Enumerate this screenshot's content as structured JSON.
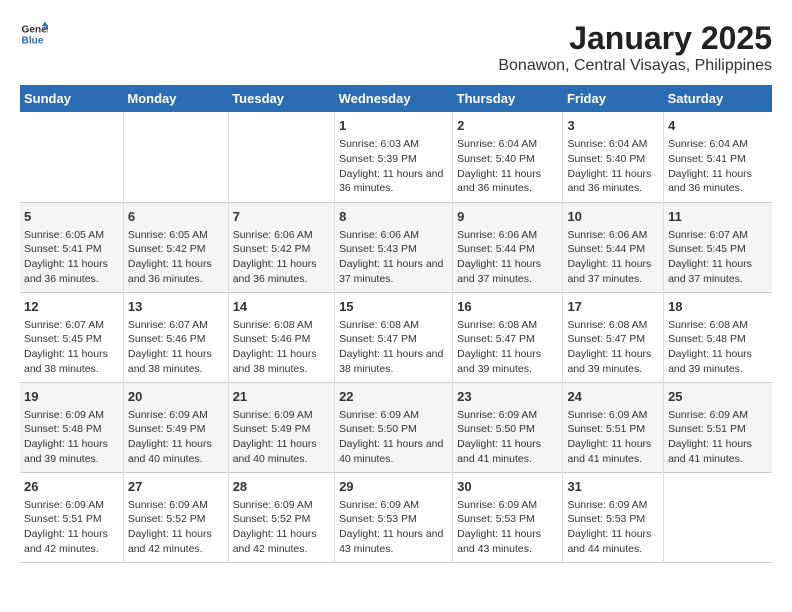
{
  "header": {
    "logo_general": "General",
    "logo_blue": "Blue",
    "title": "January 2025",
    "subtitle": "Bonawon, Central Visayas, Philippines"
  },
  "days_of_week": [
    "Sunday",
    "Monday",
    "Tuesday",
    "Wednesday",
    "Thursday",
    "Friday",
    "Saturday"
  ],
  "weeks": [
    [
      {
        "day": "",
        "info": ""
      },
      {
        "day": "",
        "info": ""
      },
      {
        "day": "",
        "info": ""
      },
      {
        "day": "1",
        "sunrise": "Sunrise: 6:03 AM",
        "sunset": "Sunset: 5:39 PM",
        "daylight": "Daylight: 11 hours and 36 minutes."
      },
      {
        "day": "2",
        "sunrise": "Sunrise: 6:04 AM",
        "sunset": "Sunset: 5:40 PM",
        "daylight": "Daylight: 11 hours and 36 minutes."
      },
      {
        "day": "3",
        "sunrise": "Sunrise: 6:04 AM",
        "sunset": "Sunset: 5:40 PM",
        "daylight": "Daylight: 11 hours and 36 minutes."
      },
      {
        "day": "4",
        "sunrise": "Sunrise: 6:04 AM",
        "sunset": "Sunset: 5:41 PM",
        "daylight": "Daylight: 11 hours and 36 minutes."
      }
    ],
    [
      {
        "day": "5",
        "sunrise": "Sunrise: 6:05 AM",
        "sunset": "Sunset: 5:41 PM",
        "daylight": "Daylight: 11 hours and 36 minutes."
      },
      {
        "day": "6",
        "sunrise": "Sunrise: 6:05 AM",
        "sunset": "Sunset: 5:42 PM",
        "daylight": "Daylight: 11 hours and 36 minutes."
      },
      {
        "day": "7",
        "sunrise": "Sunrise: 6:06 AM",
        "sunset": "Sunset: 5:42 PM",
        "daylight": "Daylight: 11 hours and 36 minutes."
      },
      {
        "day": "8",
        "sunrise": "Sunrise: 6:06 AM",
        "sunset": "Sunset: 5:43 PM",
        "daylight": "Daylight: 11 hours and 37 minutes."
      },
      {
        "day": "9",
        "sunrise": "Sunrise: 6:06 AM",
        "sunset": "Sunset: 5:44 PM",
        "daylight": "Daylight: 11 hours and 37 minutes."
      },
      {
        "day": "10",
        "sunrise": "Sunrise: 6:06 AM",
        "sunset": "Sunset: 5:44 PM",
        "daylight": "Daylight: 11 hours and 37 minutes."
      },
      {
        "day": "11",
        "sunrise": "Sunrise: 6:07 AM",
        "sunset": "Sunset: 5:45 PM",
        "daylight": "Daylight: 11 hours and 37 minutes."
      }
    ],
    [
      {
        "day": "12",
        "sunrise": "Sunrise: 6:07 AM",
        "sunset": "Sunset: 5:45 PM",
        "daylight": "Daylight: 11 hours and 38 minutes."
      },
      {
        "day": "13",
        "sunrise": "Sunrise: 6:07 AM",
        "sunset": "Sunset: 5:46 PM",
        "daylight": "Daylight: 11 hours and 38 minutes."
      },
      {
        "day": "14",
        "sunrise": "Sunrise: 6:08 AM",
        "sunset": "Sunset: 5:46 PM",
        "daylight": "Daylight: 11 hours and 38 minutes."
      },
      {
        "day": "15",
        "sunrise": "Sunrise: 6:08 AM",
        "sunset": "Sunset: 5:47 PM",
        "daylight": "Daylight: 11 hours and 38 minutes."
      },
      {
        "day": "16",
        "sunrise": "Sunrise: 6:08 AM",
        "sunset": "Sunset: 5:47 PM",
        "daylight": "Daylight: 11 hours and 39 minutes."
      },
      {
        "day": "17",
        "sunrise": "Sunrise: 6:08 AM",
        "sunset": "Sunset: 5:47 PM",
        "daylight": "Daylight: 11 hours and 39 minutes."
      },
      {
        "day": "18",
        "sunrise": "Sunrise: 6:08 AM",
        "sunset": "Sunset: 5:48 PM",
        "daylight": "Daylight: 11 hours and 39 minutes."
      }
    ],
    [
      {
        "day": "19",
        "sunrise": "Sunrise: 6:09 AM",
        "sunset": "Sunset: 5:48 PM",
        "daylight": "Daylight: 11 hours and 39 minutes."
      },
      {
        "day": "20",
        "sunrise": "Sunrise: 6:09 AM",
        "sunset": "Sunset: 5:49 PM",
        "daylight": "Daylight: 11 hours and 40 minutes."
      },
      {
        "day": "21",
        "sunrise": "Sunrise: 6:09 AM",
        "sunset": "Sunset: 5:49 PM",
        "daylight": "Daylight: 11 hours and 40 minutes."
      },
      {
        "day": "22",
        "sunrise": "Sunrise: 6:09 AM",
        "sunset": "Sunset: 5:50 PM",
        "daylight": "Daylight: 11 hours and 40 minutes."
      },
      {
        "day": "23",
        "sunrise": "Sunrise: 6:09 AM",
        "sunset": "Sunset: 5:50 PM",
        "daylight": "Daylight: 11 hours and 41 minutes."
      },
      {
        "day": "24",
        "sunrise": "Sunrise: 6:09 AM",
        "sunset": "Sunset: 5:51 PM",
        "daylight": "Daylight: 11 hours and 41 minutes."
      },
      {
        "day": "25",
        "sunrise": "Sunrise: 6:09 AM",
        "sunset": "Sunset: 5:51 PM",
        "daylight": "Daylight: 11 hours and 41 minutes."
      }
    ],
    [
      {
        "day": "26",
        "sunrise": "Sunrise: 6:09 AM",
        "sunset": "Sunset: 5:51 PM",
        "daylight": "Daylight: 11 hours and 42 minutes."
      },
      {
        "day": "27",
        "sunrise": "Sunrise: 6:09 AM",
        "sunset": "Sunset: 5:52 PM",
        "daylight": "Daylight: 11 hours and 42 minutes."
      },
      {
        "day": "28",
        "sunrise": "Sunrise: 6:09 AM",
        "sunset": "Sunset: 5:52 PM",
        "daylight": "Daylight: 11 hours and 42 minutes."
      },
      {
        "day": "29",
        "sunrise": "Sunrise: 6:09 AM",
        "sunset": "Sunset: 5:53 PM",
        "daylight": "Daylight: 11 hours and 43 minutes."
      },
      {
        "day": "30",
        "sunrise": "Sunrise: 6:09 AM",
        "sunset": "Sunset: 5:53 PM",
        "daylight": "Daylight: 11 hours and 43 minutes."
      },
      {
        "day": "31",
        "sunrise": "Sunrise: 6:09 AM",
        "sunset": "Sunset: 5:53 PM",
        "daylight": "Daylight: 11 hours and 44 minutes."
      },
      {
        "day": "",
        "info": ""
      }
    ]
  ]
}
